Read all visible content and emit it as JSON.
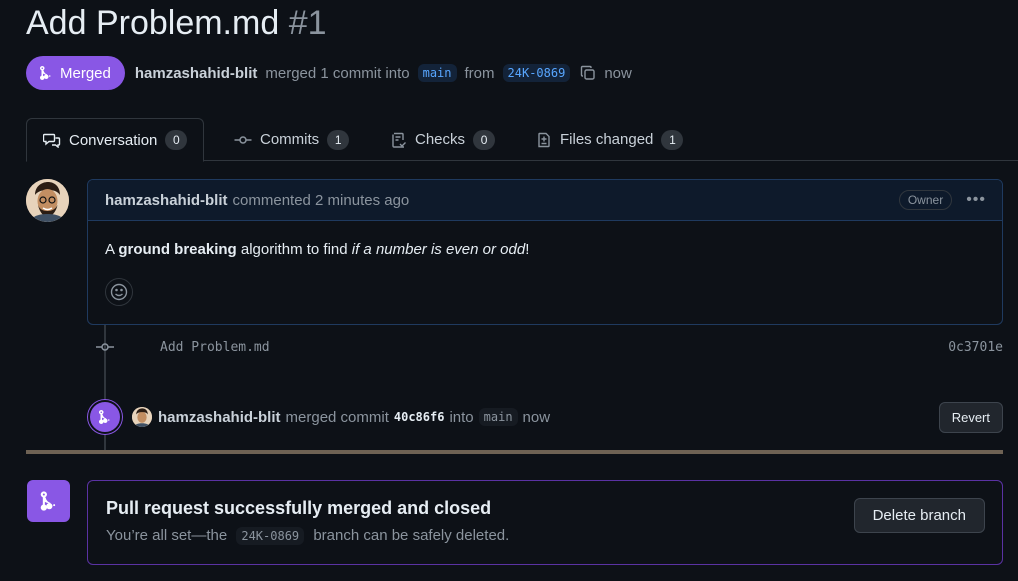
{
  "pr": {
    "title": "Add Problem.md",
    "number": "#1",
    "state": "Merged",
    "author": "hamzashahid-blit",
    "merged_text": "merged 1 commit into",
    "base_branch": "main",
    "from_text": "from",
    "head_branch": "24K-0869",
    "time": "now"
  },
  "tabs": [
    {
      "label": "Conversation",
      "count": "0",
      "icon": "comment-discussion-icon"
    },
    {
      "label": "Commits",
      "count": "1",
      "icon": "git-commit-icon"
    },
    {
      "label": "Checks",
      "count": "0",
      "icon": "checklist-icon"
    },
    {
      "label": "Files changed",
      "count": "1",
      "icon": "file-diff-icon"
    }
  ],
  "comment": {
    "author": "hamzashahid-blit",
    "meta": "commented 2 minutes ago",
    "badge": "Owner",
    "body": {
      "p1": "A ",
      "bold": "ground breaking",
      "p2": " algorithm to find ",
      "italic": "if a number is even or odd",
      "p3": "!"
    }
  },
  "commit": {
    "message": "Add Problem.md",
    "sha": "0c3701e"
  },
  "merge_event": {
    "author": "hamzashahid-blit",
    "text1": "merged commit",
    "sha": "40c86f6",
    "text2": "into",
    "branch": "main",
    "time": "now",
    "revert_label": "Revert"
  },
  "merged_box": {
    "title": "Pull request successfully merged and closed",
    "sub1": "You’re all set—the",
    "branch": "24K-0869",
    "sub2": "branch can be safely deleted.",
    "delete_label": "Delete branch"
  },
  "colors": {
    "merged": "#8957e5",
    "background": "#0d1117",
    "accent": "#58a6ff"
  }
}
